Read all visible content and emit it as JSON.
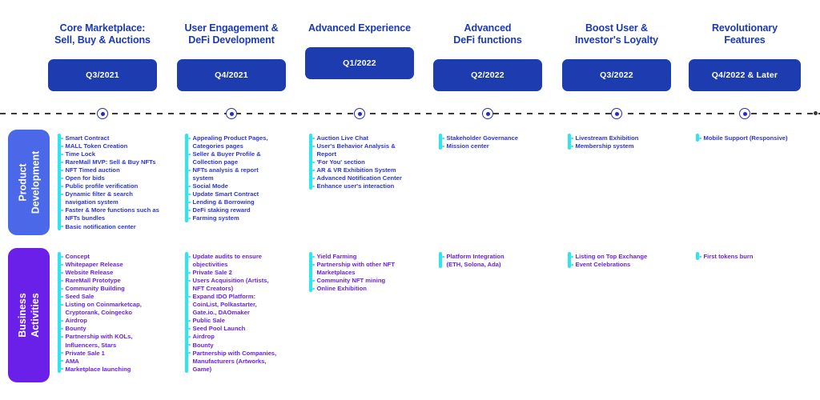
{
  "roadmap": {
    "columns": [
      {
        "title": "Core Marketplace:\nSell, Buy & Auctions",
        "quarter": "Q3/2021",
        "product_development": [
          "Smart Contract",
          "MALL Token Creation",
          "Time Lock",
          "RareMall MVP: Sell & Buy NFTs",
          "NFT Timed auction",
          "Open for bids",
          "Public profile verification",
          "Dynamic filter & search\nnavigation system",
          "Faster & More functions such as\nNFTs bundles",
          "Basic notification center"
        ],
        "business_activities": [
          "Concept",
          "Whitepaper Release",
          "Website Release",
          "RareMall Prototype",
          "Community Building",
          "Seed Sale",
          "Listing on Coinmarketcap,\nCryptorank, Coingecko",
          "Airdrop",
          "Bounty",
          "Partnership with KOLs,\nInfluencers, Stars",
          "Private Sale 1",
          "AMA",
          "Marketplace launching"
        ]
      },
      {
        "title": "User Engagement &\nDeFi Development",
        "quarter": "Q4/2021",
        "product_development": [
          "Appealing Product Pages,\nCategories pages",
          "Seller & Buyer Profile &\nCollection page",
          "NFTs analysis & report\nsystem",
          "Social Mode",
          "Update Smart Contract",
          "Lending & Borrowing",
          "DeFi staking reward",
          "Farming system"
        ],
        "business_activities": [
          "Update audits to ensure\nobjectivities",
          "Private Sale 2",
          "Users Acquisition (Artists,\nNFT Creators)",
          "Expand IDO Platform:\nCoinList, Polkastarter,\nGate.io., DAOmaker",
          "Public Sale",
          "Seed Pool Launch",
          "Airdrop",
          "Bounty",
          "Partnership with Companies,\nManufacturers (Artworks,\nGame)"
        ]
      },
      {
        "title": "Advanced Experience",
        "quarter": "Q1/2022",
        "product_development": [
          "Auction Live Chat",
          "User's Behavior Analysis &\nReport",
          "'For You' section",
          "AR & VR Exhibition System",
          "Advanced Notification Center",
          "Enhance user's interaction"
        ],
        "business_activities": [
          "Yield Farming",
          "Partnership with other NFT\nMarketplaces",
          "Community NFT mining",
          "Online Exhibition"
        ]
      },
      {
        "title": "Advanced\nDeFi functions",
        "quarter": "Q2/2022",
        "product_development": [
          "Stakeholder Governance",
          "Mission center"
        ],
        "business_activities": [
          "Platform Integration\n(ETH, Solona, Ada)"
        ]
      },
      {
        "title": "Boost User &\nInvestor's Loyalty",
        "quarter": "Q3/2022",
        "product_development": [
          "Livestream Exhibition",
          "Membership system"
        ],
        "business_activities": [
          "Listing on Top Exchange",
          "Event Celebrations"
        ]
      },
      {
        "title": "Revolutionary\nFeatures",
        "quarter": "Q4/2022 & Later",
        "product_development": [
          "Mobile Support (Responsive)"
        ],
        "business_activities": [
          "First tokens burn"
        ]
      }
    ],
    "rows": [
      {
        "label_line1": "Product",
        "label_line2": "Development"
      },
      {
        "label_line1": "Business",
        "label_line2": "Activities"
      }
    ],
    "colors": {
      "title": "#1b39b5",
      "quarter_box": "#1d3cb0",
      "product_row": "#4a68e8",
      "business_row": "#6a20e8",
      "accent": "#2ee6f0",
      "product_text": "#2b35d8",
      "business_text": "#6a20e8",
      "timeline": "#3b3b3b"
    }
  }
}
